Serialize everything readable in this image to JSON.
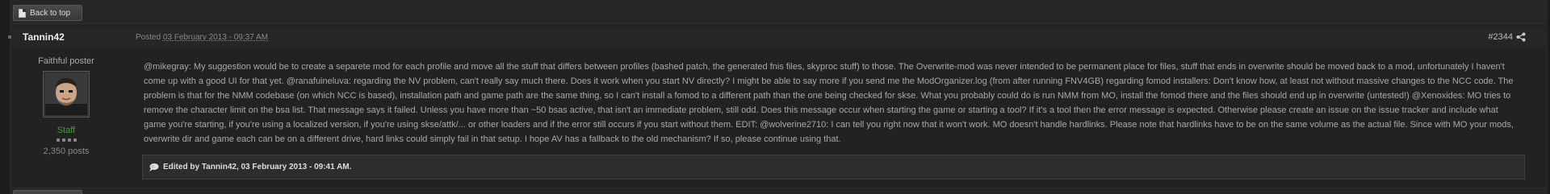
{
  "top": {
    "back_label": "Back to top"
  },
  "post": {
    "author": "Tannin42",
    "posted_prefix": "Posted",
    "posted_date": "03 February 2013 - 09:37 AM",
    "post_number": "#2344",
    "rank": "Faithful poster",
    "role": "Staff",
    "post_count": "2,350 posts",
    "role_color": "#3aa23a",
    "body": "@mikegray: My suggestion would be to create a separete mod for each profile and move all the stuff that differs between profiles (bashed patch, the generated fnis files, skyproc stuff) to those. The Overwrite-mod was never intended to be permanent place for files, stuff that ends in overwrite should be moved back to a mod, unfortunately I haven't come up with a good UI for that yet. @ranafuineluva: regarding the NV problem, can't really say much there. Does it work when you start NV directly? I might be able to say more if you send me the ModOrganizer.log (from after running FNV4GB) regarding fomod installers: Don't know how, at least not without massive changes to the NCC code. The problem is that for the NMM codebase (on which NCC is based), installation path and game path are the same thing, so I can't install a fomod to a different path than the one being checked for skse. What you probably could do is run NMM from MO, install the fomod there and the files should end up in overwrite (untested!) @Xenoxides: MO tries to remove the character limit on the bsa list. That message says it failed. Unless you have more than ~50 bsas active, that isn't an immediate problem, still odd. Does this message occur when starting the game or starting a tool? If it's a tool then the error message is expected. Otherwise please create an issue on the issue tracker and include what game you're starting, if you're using a localized version, if you're using skse/attk/... or other loaders and if the error still occurs if you start without them. EDIT: @wolverine2710: I can tell you right now that it won't work. MO doesn't handle hardlinks. Please note that hardlinks have to be on the same volume as the actual file. Since with MO your mods, overwrite dir and game each can be on a different drive, hard links could simply fail in that setup. I hope AV has a fallback to the old mechanism? If so, please continue using that.",
    "edited": "Edited by Tannin42, 03 February 2013 - 09:41 AM."
  },
  "icons": {
    "back": "document-icon",
    "share": "share-icon",
    "edit": "speech-bubble-icon",
    "avatar": "user-avatar"
  }
}
